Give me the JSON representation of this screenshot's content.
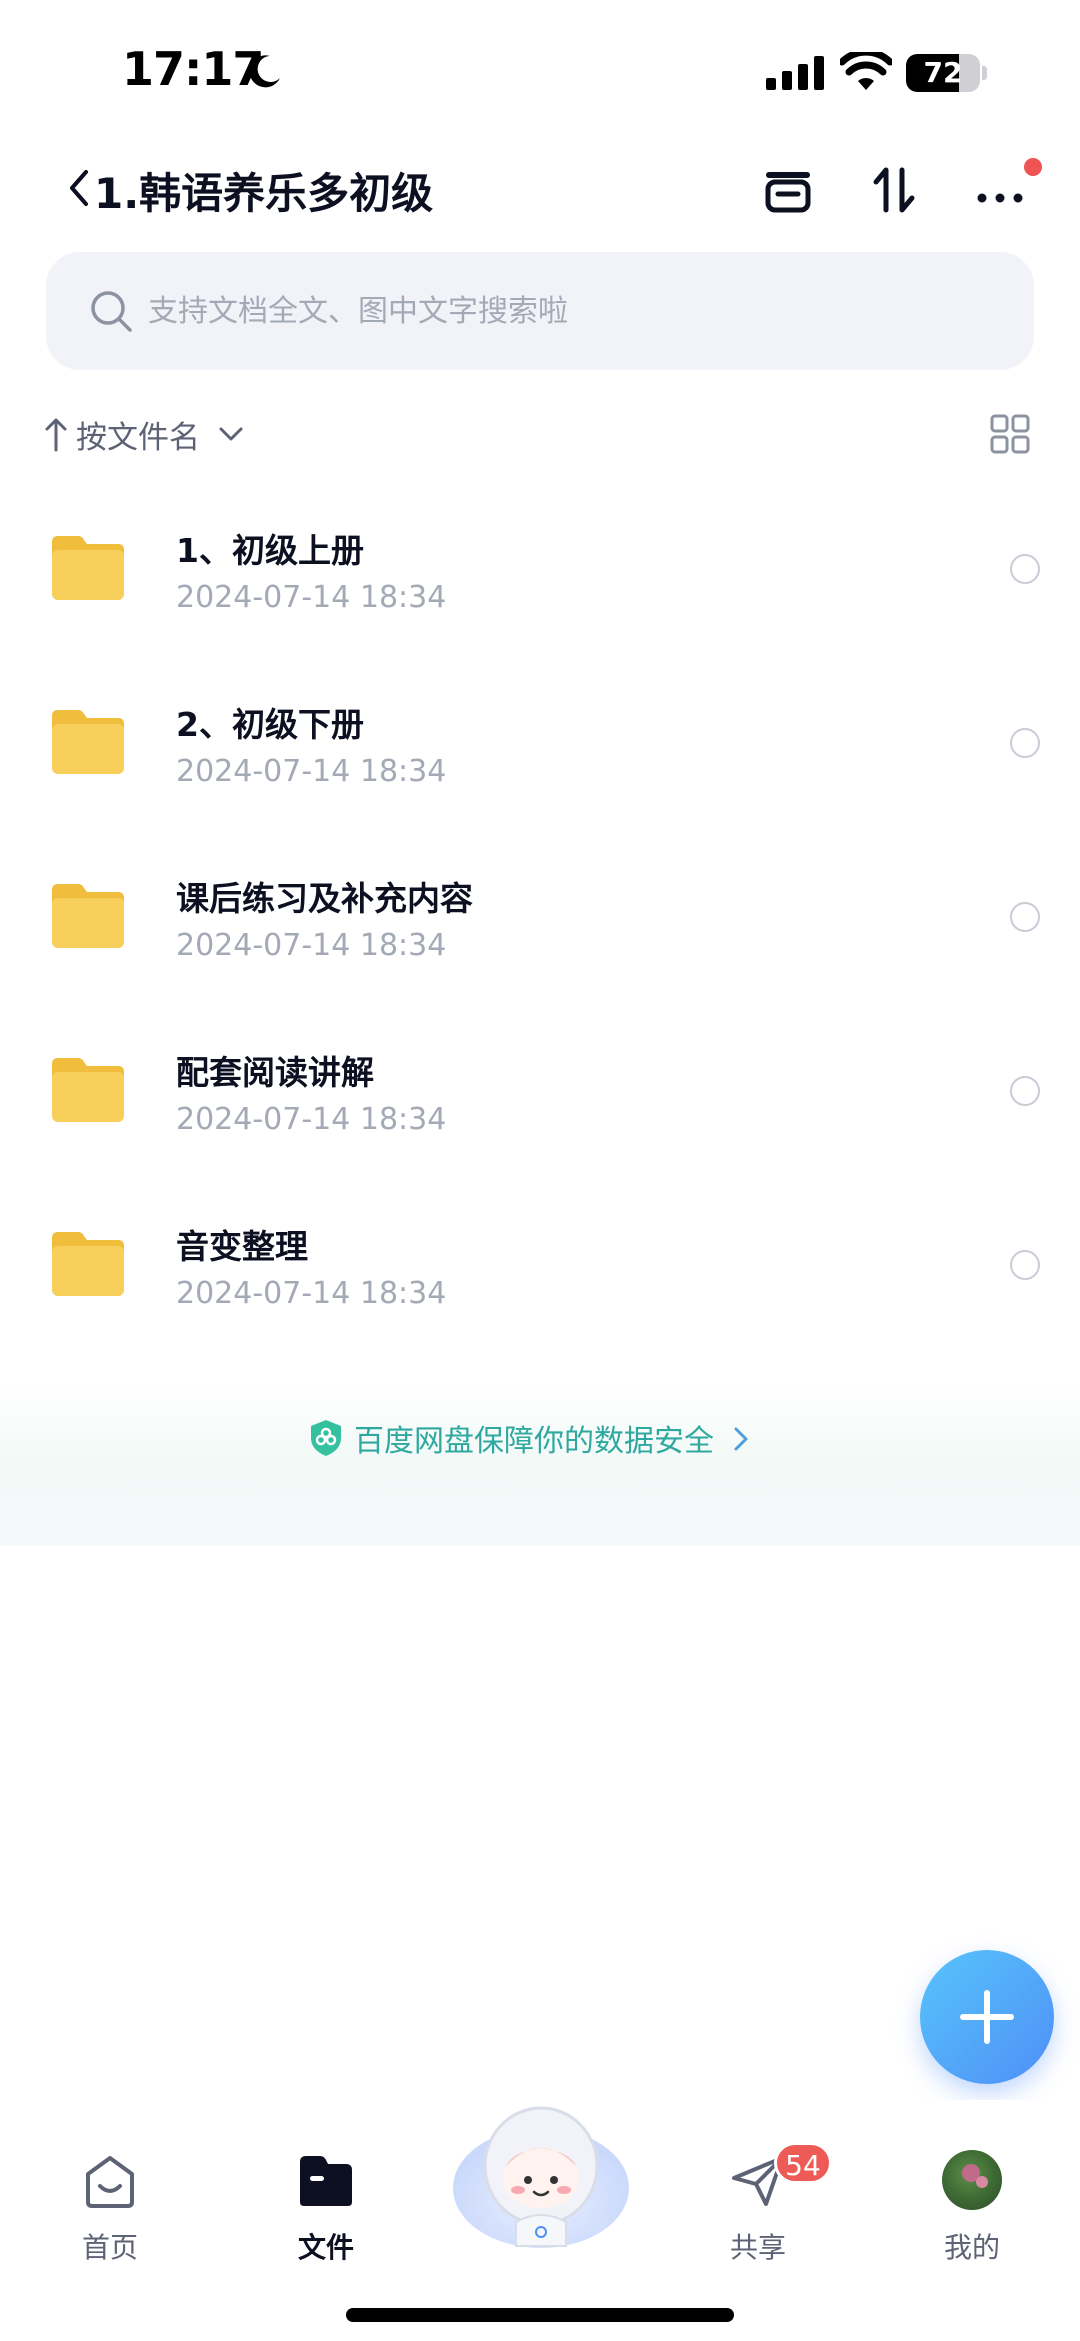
{
  "status_bar": {
    "time": "17:17",
    "battery": "72",
    "battery_level": 0.72
  },
  "header": {
    "title": "1.韩语养乐多初级"
  },
  "search": {
    "placeholder": "支持文档全文、图中文字搜索啦"
  },
  "sort": {
    "label": "按文件名"
  },
  "files": [
    {
      "name": "1、初级上册",
      "date": "2024-07-14 18:34"
    },
    {
      "name": "2、初级下册",
      "date": "2024-07-14 18:34"
    },
    {
      "name": "课后练习及补充内容",
      "date": "2024-07-14 18:34"
    },
    {
      "name": "配套阅读讲解",
      "date": "2024-07-14 18:34"
    },
    {
      "name": "音变整理",
      "date": "2024-07-14 18:34"
    }
  ],
  "safety_banner": {
    "text": "百度网盘保障你的数据安全"
  },
  "bottom_nav": {
    "home": "首页",
    "files": "文件",
    "share": "共享",
    "share_badge": "54",
    "mine": "我的"
  },
  "colors": {
    "accent": "#4f8ff7",
    "safety": "#2fa9a0",
    "badge": "#ee5a55",
    "folder": "#f8cf5a"
  }
}
